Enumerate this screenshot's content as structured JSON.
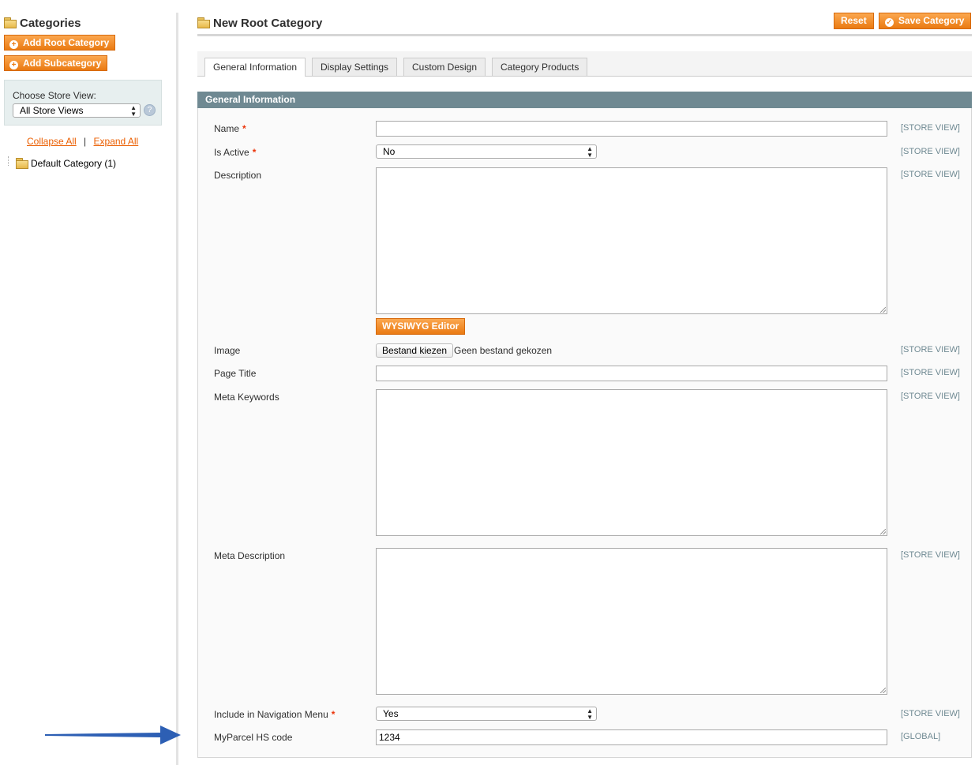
{
  "sidebar": {
    "title": "Categories",
    "add_root_label": "Add Root Category",
    "add_sub_label": "Add Subcategory",
    "store_view_label": "Choose Store View:",
    "store_view_value": "All Store Views",
    "collapse_all": "Collapse All",
    "separator": "|",
    "expand_all": "Expand All",
    "tree": [
      {
        "label": "Default Category (1)"
      }
    ]
  },
  "header": {
    "title": "New Root Category",
    "reset_label": "Reset",
    "save_label": "Save Category"
  },
  "tabs": [
    {
      "label": "General Information",
      "active": true
    },
    {
      "label": "Display Settings",
      "active": false
    },
    {
      "label": "Custom Design",
      "active": false
    },
    {
      "label": "Category Products",
      "active": false
    }
  ],
  "section": {
    "title": "General Information"
  },
  "form": {
    "name": {
      "label": "Name",
      "required": "*",
      "value": "",
      "scope": "[STORE VIEW]"
    },
    "is_active": {
      "label": "Is Active",
      "required": "*",
      "value": "No",
      "scope": "[STORE VIEW]"
    },
    "description": {
      "label": "Description",
      "value": "",
      "scope": "[STORE VIEW]",
      "wysiwyg_label": "WYSIWYG Editor"
    },
    "image": {
      "label": "Image",
      "button_label": "Bestand kiezen",
      "status": "Geen bestand gekozen",
      "scope": "[STORE VIEW]"
    },
    "page_title": {
      "label": "Page Title",
      "value": "",
      "scope": "[STORE VIEW]"
    },
    "meta_keywords": {
      "label": "Meta Keywords",
      "value": "",
      "scope": "[STORE VIEW]"
    },
    "meta_description": {
      "label": "Meta Description",
      "value": "",
      "scope": "[STORE VIEW]"
    },
    "include_nav": {
      "label": "Include in Navigation Menu",
      "required": "*",
      "value": "Yes",
      "scope": "[STORE VIEW]"
    },
    "hs_code": {
      "label": "MyParcel HS code",
      "value": "1234",
      "scope": "[GLOBAL]"
    }
  },
  "colors": {
    "accent": "#ea7a12",
    "section_header": "#6f8992",
    "annotation_arrow": "#2d5fb4"
  }
}
